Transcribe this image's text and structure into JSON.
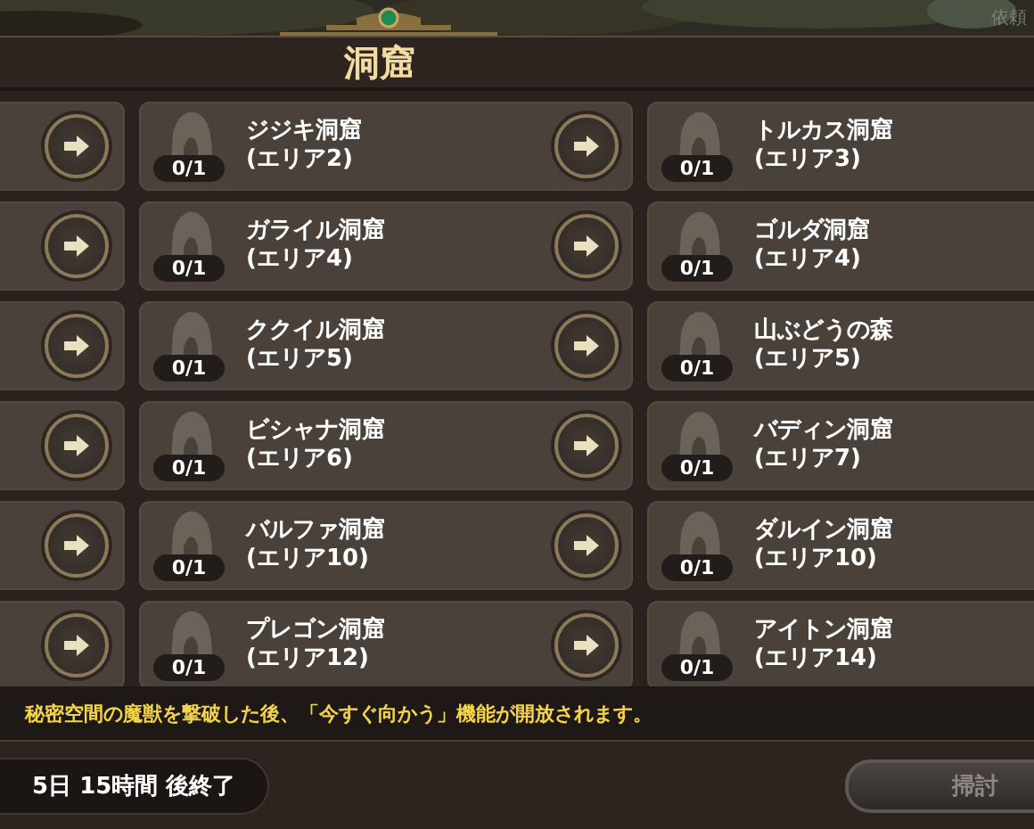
{
  "top_corner_label": "依頼",
  "title": "洞窟",
  "caves": [
    {
      "name": "ジジキ洞窟",
      "area": "(エリア2)",
      "progress": "0/1"
    },
    {
      "name": "トルカス洞窟",
      "area": "(エリア3)",
      "progress": "0/1"
    },
    {
      "name": "ガライル洞窟",
      "area": "(エリア4)",
      "progress": "0/1"
    },
    {
      "name": "ゴルダ洞窟",
      "area": "(エリア4)",
      "progress": "0/1"
    },
    {
      "name": "ククイル洞窟",
      "area": "(エリア5)",
      "progress": "0/1"
    },
    {
      "name": "山ぶどうの森",
      "area": "(エリア5)",
      "progress": "0/1"
    },
    {
      "name": "ビシャナ洞窟",
      "area": "(エリア6)",
      "progress": "0/1"
    },
    {
      "name": "バディン洞窟",
      "area": "(エリア7)",
      "progress": "0/1"
    },
    {
      "name": "バルファ洞窟",
      "area": "(エリア10)",
      "progress": "0/1"
    },
    {
      "name": "ダルイン洞窟",
      "area": "(エリア10)",
      "progress": "0/1"
    },
    {
      "name": "プレゴン洞窟",
      "area": "(エリア12)",
      "progress": "0/1"
    },
    {
      "name": "アイトン洞窟",
      "area": "(エリア14)",
      "progress": "0/1"
    }
  ],
  "notice": "秘密空間の魔獣を撃破した後、「今すぐ向かう」機能が開放されます。",
  "timer": "5日 15時間 後終了",
  "sweep_button": {
    "label": "掃討",
    "disabled": true
  }
}
